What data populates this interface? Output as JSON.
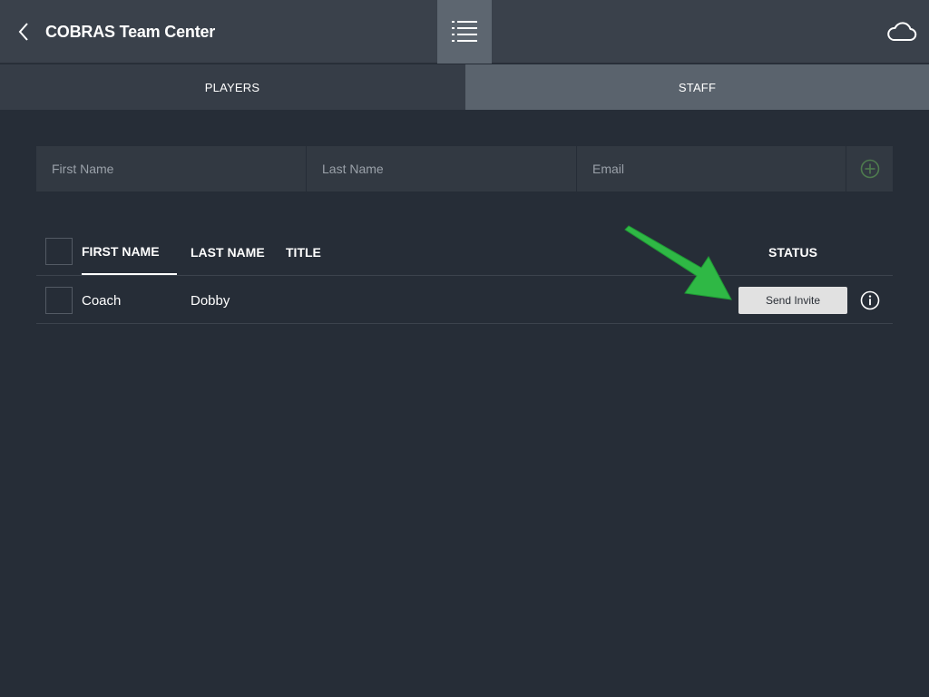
{
  "header": {
    "title": "COBRAS Team Center",
    "back_icon": "chevron-left-icon",
    "menu_icon": "list-icon",
    "cloud_icon": "cloud-icon"
  },
  "tabs": [
    {
      "label": "PLAYERS",
      "active": false
    },
    {
      "label": "STAFF",
      "active": true
    }
  ],
  "add_form": {
    "first_name_placeholder": "First Name",
    "last_name_placeholder": "Last Name",
    "email_placeholder": "Email",
    "add_icon": "plus-circle-icon",
    "add_icon_color": "#4e7b4e"
  },
  "table": {
    "columns": {
      "first_name": "FIRST NAME",
      "last_name": "LAST NAME",
      "title": "TITLE",
      "status": "STATUS"
    },
    "rows": [
      {
        "first_name": "Coach",
        "last_name": "Dobby",
        "title": "",
        "status_button": "Send Invite",
        "info_icon": "info-icon"
      }
    ]
  },
  "annotation": {
    "arrow_color": "#2fb845"
  }
}
